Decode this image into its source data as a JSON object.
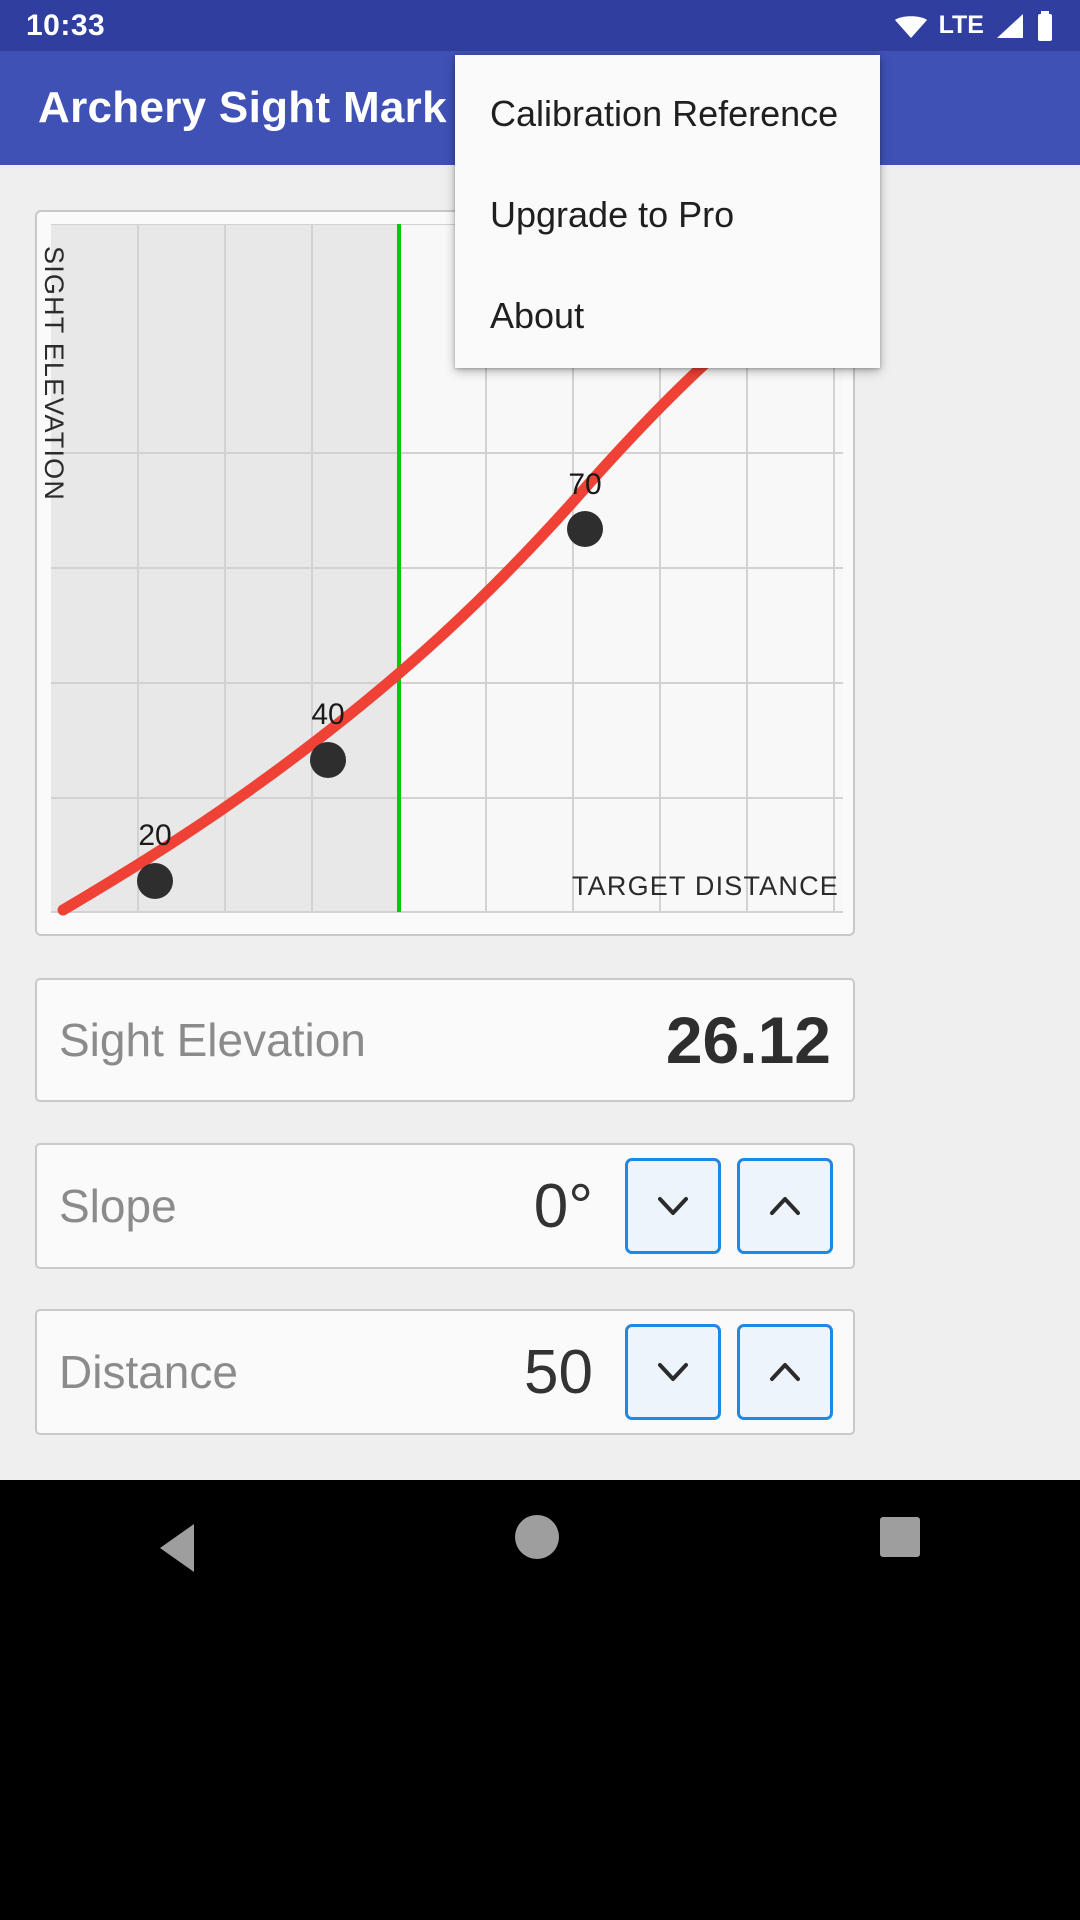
{
  "status_bar": {
    "time": "10:33",
    "network_label": "LTE",
    "icons": [
      "wifi-icon",
      "signal-icon",
      "battery-icon"
    ],
    "background": "#303f9f"
  },
  "app_bar": {
    "title": "Archery Sight Mark",
    "background": "#3f51b5",
    "overflow_icon": "more-vert-icon"
  },
  "overflow_menu": {
    "visible": true,
    "items": [
      {
        "label": "Calibration Reference"
      },
      {
        "label": "Upgrade to Pro"
      },
      {
        "label": "About"
      }
    ]
  },
  "chart_data": {
    "type": "line",
    "title": "",
    "xlabel": "TARGET DISTANCE",
    "ylabel": "SIGHT ELEVATION",
    "grid": true,
    "legend": "none",
    "xlim": [
      10,
      100
    ],
    "ylim": [
      0,
      60
    ],
    "series": [
      {
        "name": "Sight mark curve",
        "color": "#ef4136",
        "x": [
          10,
          20,
          30,
          40,
          50,
          60,
          70,
          80,
          90
        ],
        "y": [
          3.0,
          7.5,
          12.5,
          18.0,
          26.12,
          34.5,
          43.5,
          53.0,
          60.0
        ]
      }
    ],
    "points": [
      {
        "label": "20",
        "x": 20,
        "y": 7.5
      },
      {
        "label": "40",
        "x": 40,
        "y": 18.0
      },
      {
        "label": "70",
        "x": 70,
        "y": 43.5
      }
    ],
    "marker_color": "#2e2e2e",
    "cursor_line": {
      "x": 50,
      "color": "#00cc00"
    },
    "plot_bg": "#f8f8f8",
    "shaded_bg": "#e8e8e8",
    "gridline_color": "#d2d2d2"
  },
  "rows": [
    {
      "label": "Sight Elevation",
      "value": "26.12",
      "has_stepper": false
    },
    {
      "label": "Slope",
      "value": "0°",
      "has_stepper": true
    },
    {
      "label": "Distance",
      "value": "50",
      "has_stepper": true
    }
  ],
  "stepper": {
    "decrement_icon": "chevron-down-icon",
    "increment_icon": "chevron-up-icon",
    "accent": "#1e88e5"
  },
  "nav_bar": {
    "back_icon": "back-triangle-icon",
    "home_icon": "home-circle-icon",
    "recents_icon": "recents-square-icon"
  }
}
